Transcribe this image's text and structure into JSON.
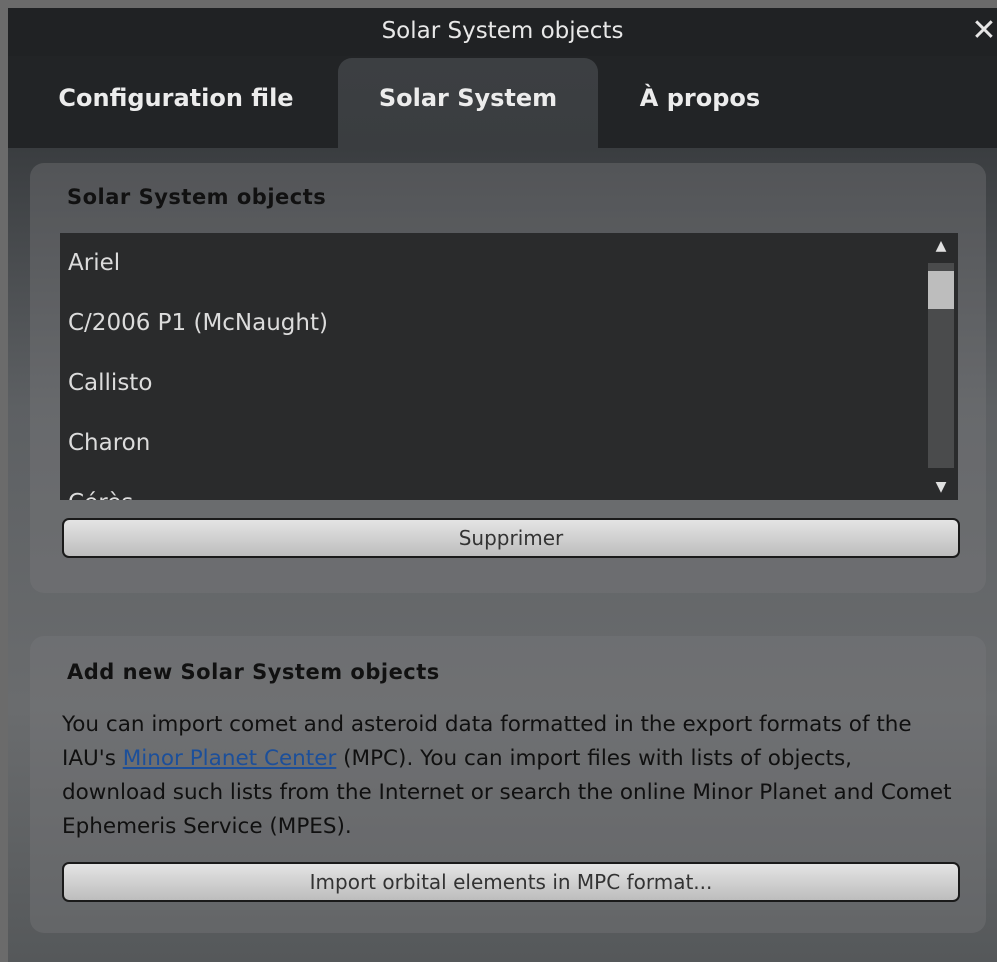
{
  "window": {
    "title": "Solar System objects",
    "close_glyph": "✕"
  },
  "tabs": [
    {
      "label": "Configuration file"
    },
    {
      "label": "Solar System"
    },
    {
      "label": "À propos"
    }
  ],
  "objects_section": {
    "title": "Solar System objects",
    "items": [
      {
        "label": "Ariel"
      },
      {
        "label": "C/2006 P1 (McNaught)"
      },
      {
        "label": "Callisto"
      },
      {
        "label": "Charon"
      },
      {
        "label": "Cérès"
      }
    ],
    "remove_button": "Supprimer",
    "scroll_up_glyph": "▲",
    "scroll_down_glyph": "▼"
  },
  "add_section": {
    "title": "Add new Solar System objects",
    "text_before": "You can import comet and asteroid data formatted in the export formats of the IAU's ",
    "link_text": "Minor Planet Center",
    "text_after": " (MPC). You can import files with lists of objects, download such lists from the Internet or search the online Minor Planet and Comet Ephemeris Service (MPES).",
    "import_button": "Import orbital elements in MPC format..."
  }
}
